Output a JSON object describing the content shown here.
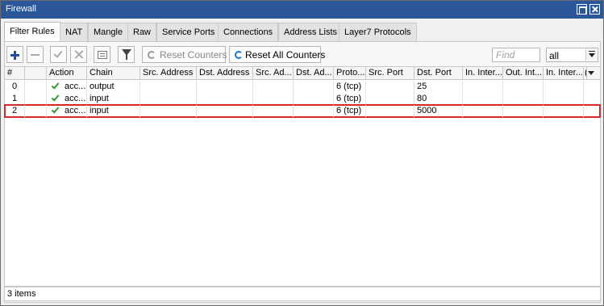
{
  "window": {
    "title": "Firewall"
  },
  "tabs": [
    {
      "label": "Filter Rules",
      "active": true
    },
    {
      "label": "NAT"
    },
    {
      "label": "Mangle"
    },
    {
      "label": "Raw"
    },
    {
      "label": "Service Ports"
    },
    {
      "label": "Connections"
    },
    {
      "label": "Address Lists"
    },
    {
      "label": "Layer7 Protocols"
    }
  ],
  "toolbar": {
    "buttons": [
      {
        "icon": "add-icon",
        "enabled": true
      },
      {
        "icon": "remove-icon",
        "enabled": false
      },
      {
        "icon": "enable-icon",
        "enabled": false
      },
      {
        "icon": "disable-icon",
        "enabled": false
      },
      {
        "icon": "comment-icon",
        "enabled": true
      },
      {
        "icon": "filter-icon",
        "enabled": true
      }
    ],
    "reset_counters": "Reset Counters",
    "reset_all_counters": "Reset All Counters",
    "find_placeholder": "Find",
    "filter_select": "all"
  },
  "table": {
    "columns": [
      "#",
      "",
      "Action",
      "Chain",
      "Src. Address",
      "Dst. Address",
      "Src. Ad...",
      "Dst. Ad...",
      "Proto...",
      "Src. Port",
      "Dst. Port",
      "In. Inter...",
      "Out. Int...",
      "In. Inter...",
      "("
    ],
    "rows": [
      {
        "num": "0",
        "action": "acc...",
        "chain": "output",
        "protocol": "6 (tcp)",
        "dst_port": "25",
        "highlighted": false
      },
      {
        "num": "1",
        "action": "acc...",
        "chain": "input",
        "protocol": "6 (tcp)",
        "dst_port": "80",
        "highlighted": false
      },
      {
        "num": "2",
        "action": "acc...",
        "chain": "input",
        "protocol": "6 (tcp)",
        "dst_port": "5000",
        "highlighted": true
      }
    ]
  },
  "status": {
    "items": "3 items"
  },
  "colors": {
    "titlebar": "#2b579a",
    "highlight": "#d42a2a",
    "accept_check": "#2f9b2f",
    "add_icon": "#1e4fa8"
  }
}
